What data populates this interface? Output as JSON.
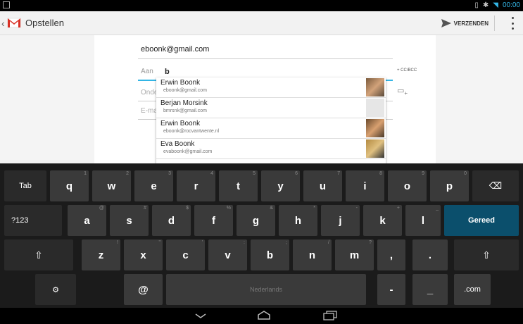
{
  "status": {
    "clock": "00:00"
  },
  "actionbar": {
    "title": "Opstellen",
    "send_label": "VERZENDEN"
  },
  "compose": {
    "from": "eboonk@gmail.com",
    "to_label": "Aan",
    "to_value": "b",
    "cc_bcc": "+ CC/BCC",
    "subject_hint": "Onde",
    "body_hint": "E-ma"
  },
  "suggestions": [
    {
      "name": "Erwin Boonk",
      "email": "eboonk@gmail.com"
    },
    {
      "name": "Berjan Morsink",
      "email": "bmrsnk@gmail.com"
    },
    {
      "name": "Erwin Boonk",
      "email": "eboonk@rocvantwente.nl"
    },
    {
      "name": "Eva Boonk",
      "email": "evaboonk@gmail.com"
    }
  ],
  "keyboard": {
    "tab": "Tab",
    "row1": [
      {
        "k": "q",
        "h": "1"
      },
      {
        "k": "w",
        "h": "2"
      },
      {
        "k": "e",
        "h": "3"
      },
      {
        "k": "r",
        "h": "4"
      },
      {
        "k": "t",
        "h": "5"
      },
      {
        "k": "y",
        "h": "6"
      },
      {
        "k": "u",
        "h": "7"
      },
      {
        "k": "i",
        "h": "8"
      },
      {
        "k": "o",
        "h": "9"
      },
      {
        "k": "p",
        "h": "0"
      }
    ],
    "sym": "?123",
    "row2": [
      {
        "k": "a",
        "h": "@"
      },
      {
        "k": "s",
        "h": "#"
      },
      {
        "k": "d",
        "h": "$"
      },
      {
        "k": "f",
        "h": "%"
      },
      {
        "k": "g",
        "h": "&"
      },
      {
        "k": "h",
        "h": "*"
      },
      {
        "k": "j",
        "h": "-"
      },
      {
        "k": "k",
        "h": "+"
      },
      {
        "k": "l",
        "h": "_"
      }
    ],
    "done": "Gereed",
    "row3": [
      {
        "k": "z",
        "h": "!"
      },
      {
        "k": "x",
        "h": "\""
      },
      {
        "k": "c",
        "h": "'"
      },
      {
        "k": "v",
        "h": ":"
      },
      {
        "k": "b",
        "h": ";"
      },
      {
        "k": "n",
        "h": "/"
      },
      {
        "k": "m",
        "h": "?"
      },
      {
        "k": ",",
        "h": ""
      },
      {
        "k": ".",
        "h": ""
      }
    ],
    "at": "@",
    "space": "Nederlands",
    "dash": "-",
    "underscore": "_",
    "dotcom": ".com"
  }
}
